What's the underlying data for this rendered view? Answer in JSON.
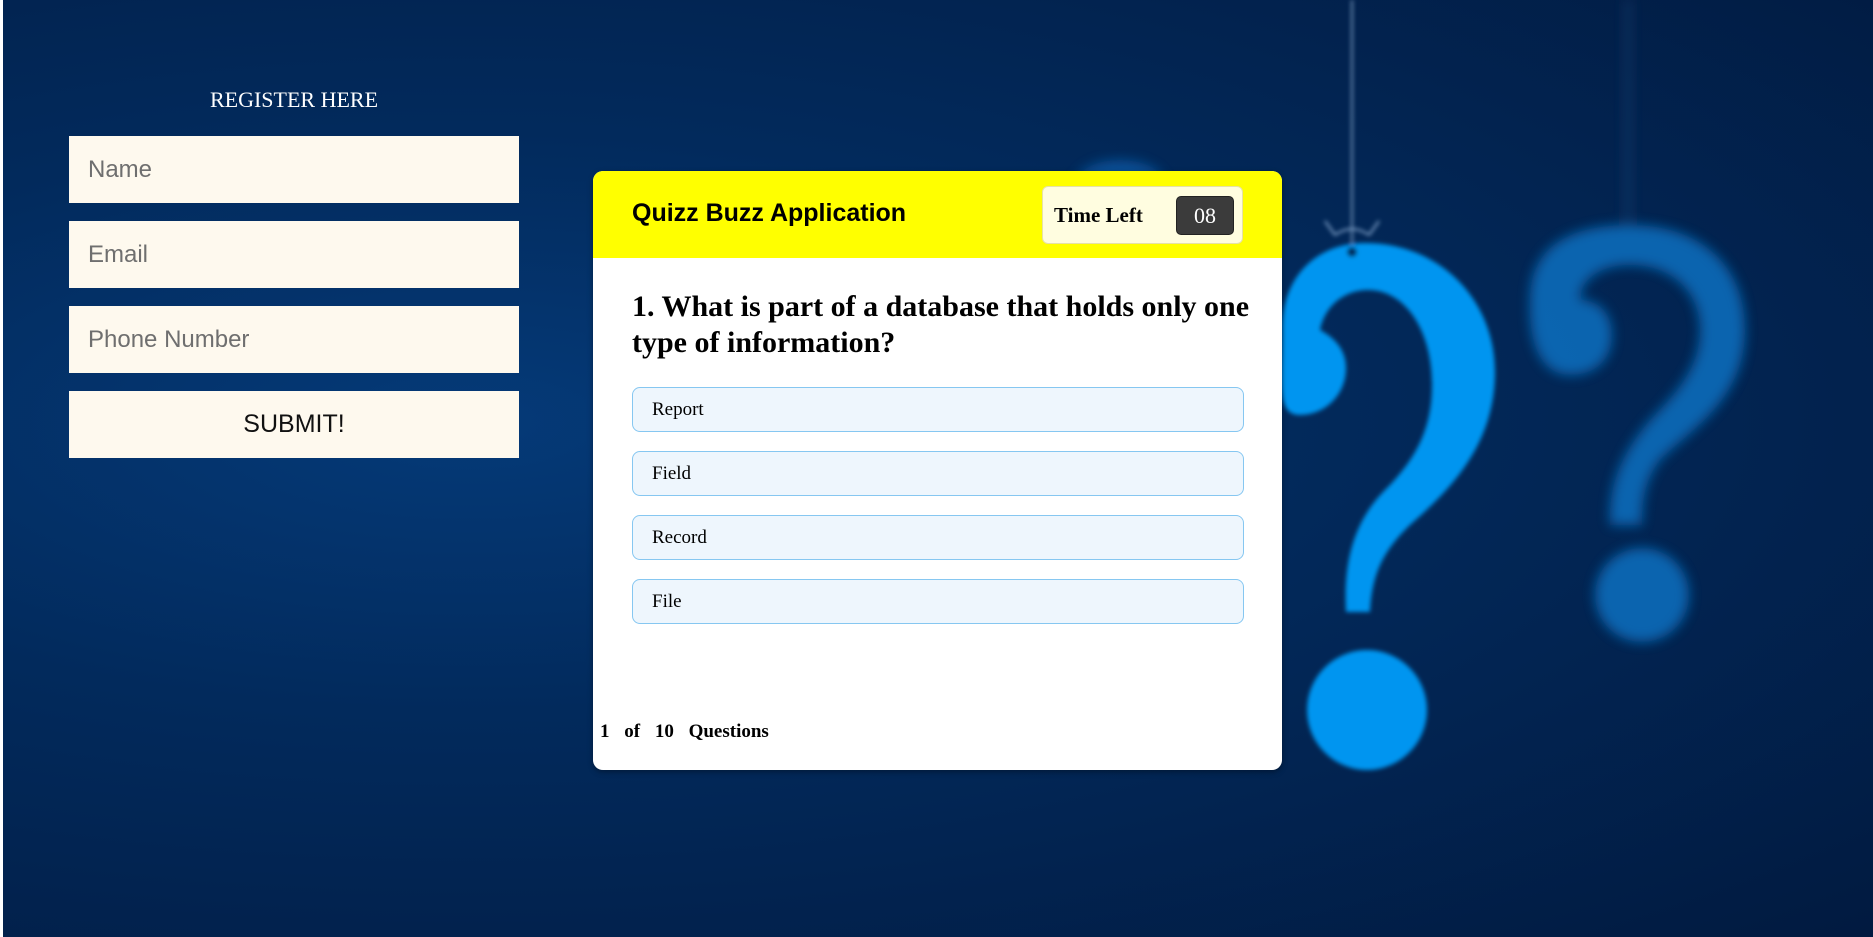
{
  "register": {
    "title": "REGISTER HERE",
    "name_placeholder": "Name",
    "email_placeholder": "Email",
    "phone_placeholder": "Phone Number",
    "submit_label": "SUBMIT!"
  },
  "quiz": {
    "title": "Quizz Buzz Application",
    "timer_label": "Time Left",
    "timer_value": "08",
    "question": "1. What is part of a database that holds only one type of information?",
    "options": [
      "Report",
      "Field",
      "Record",
      "File"
    ],
    "footer": {
      "current": "1",
      "of": "of",
      "total": "10",
      "suffix": "Questions"
    }
  },
  "colors": {
    "background": "#022a5c",
    "header_yellow": "#ffff00",
    "option_border": "#86c7f1",
    "question_mark_blue": "#0095f0"
  },
  "icons": {
    "decor": "question-mark-icon"
  }
}
